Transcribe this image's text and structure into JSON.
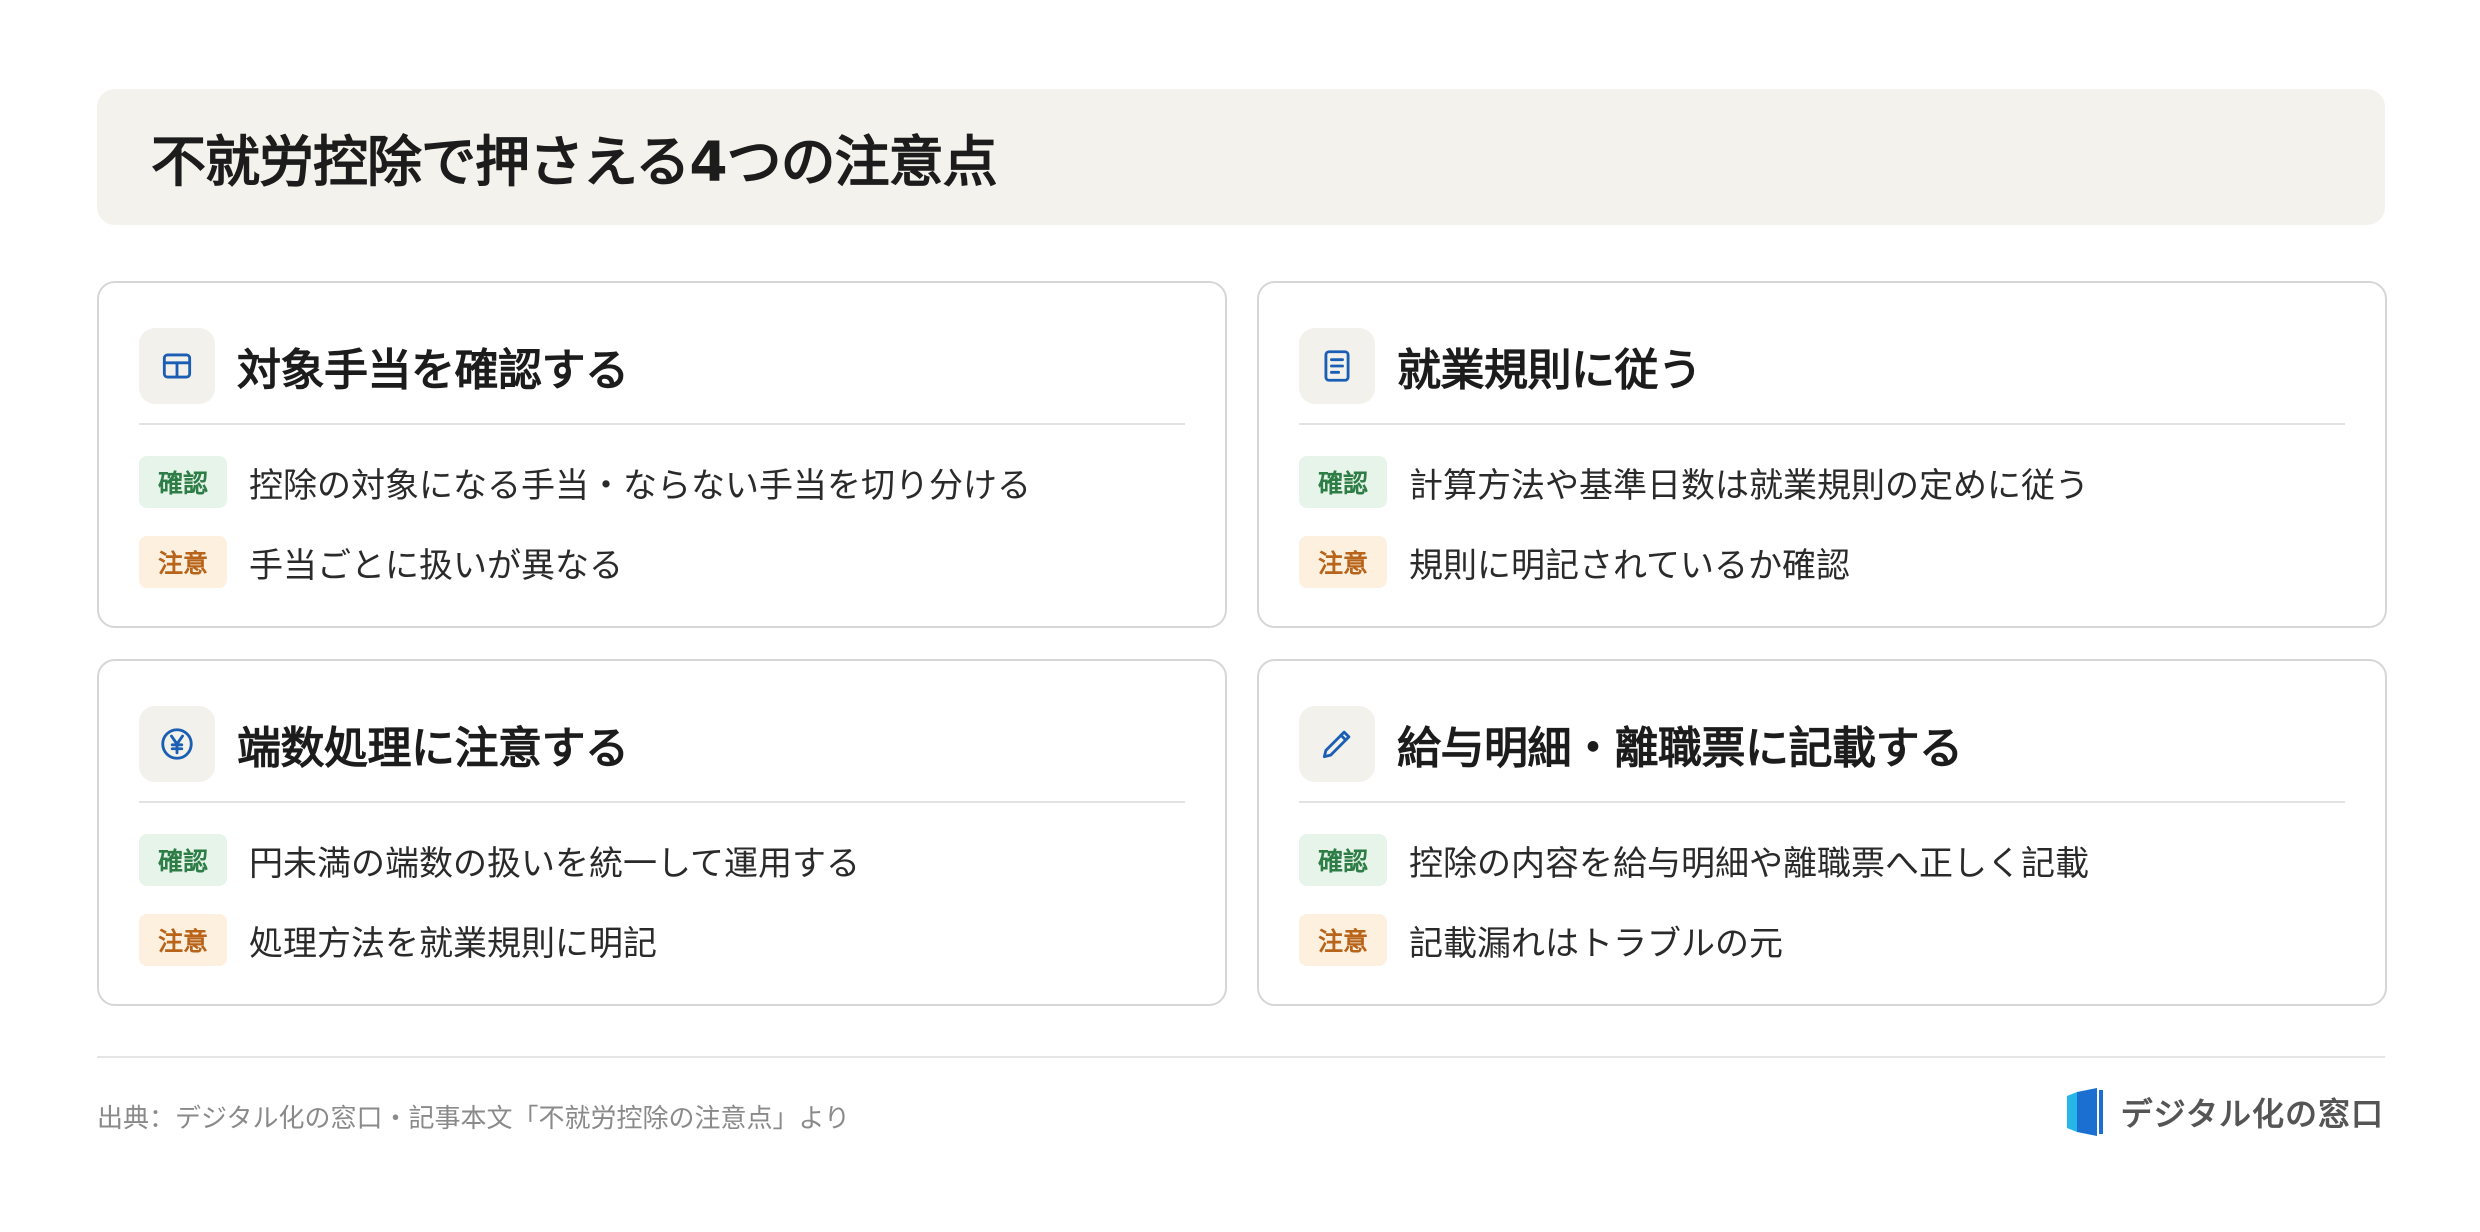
{
  "title": "不就労控除で押さえる4つの注意点",
  "cards": [
    {
      "icon": "table-icon",
      "title": "対象手当を確認する",
      "rows": [
        {
          "badge": "確認",
          "text": "控除の対象になる手当・ならない手当を切り分ける"
        },
        {
          "badge": "注意",
          "text": "手当ごとに扱いが異なる"
        }
      ]
    },
    {
      "icon": "document-icon",
      "title": "就業規則に従う",
      "rows": [
        {
          "badge": "確認",
          "text": "計算方法や基準日数は就業規則の定めに従う"
        },
        {
          "badge": "注意",
          "text": "規則に明記されているか確認"
        }
      ]
    },
    {
      "icon": "yen-icon",
      "title": "端数処理に注意する",
      "rows": [
        {
          "badge": "確認",
          "text": "円未満の端数の扱いを統一して運用する"
        },
        {
          "badge": "注意",
          "text": "処理方法を就業規則に明記"
        }
      ]
    },
    {
      "icon": "pencil-icon",
      "title": "給与明細・離職票に記載する",
      "rows": [
        {
          "badge": "確認",
          "text": "控除の内容を給与明細や離職票へ正しく記載"
        },
        {
          "badge": "注意",
          "text": "記載漏れはトラブルの元"
        }
      ]
    }
  ],
  "footer": {
    "source": "出典：デジタル化の窓口・記事本文「不就労控除の注意点」より",
    "logo_text": "デジタル化の窓口"
  },
  "colors": {
    "icon_blue": "#1a5fb4",
    "confirm_green": "#2e7d46",
    "caution_orange": "#b8641a",
    "logo_blue": "#1a6fd1",
    "logo_cyan": "#27b6e8"
  }
}
